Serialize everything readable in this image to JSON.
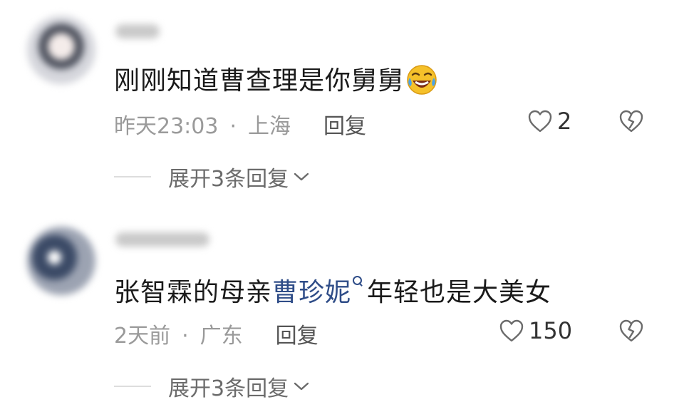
{
  "comments": [
    {
      "text": "刚刚知道曹查理是你舅舅",
      "emoji": "rofl-emoji",
      "time": "昨天23:03",
      "separator": "·",
      "location": "上海",
      "reply_label": "回复",
      "likes": "2",
      "expand_label": "展开3条回复"
    },
    {
      "text_before": "张智霖的母亲",
      "mention": "曹珍妮",
      "text_after": "年轻也是大美女",
      "time": "2天前",
      "separator": "·",
      "location": "广东",
      "reply_label": "回复",
      "likes": "150",
      "expand_label": "展开3条回复"
    }
  ],
  "icons": {
    "like": "heart-outline-icon",
    "dislike": "broken-heart-icon",
    "expand": "chevron-down-icon",
    "mention_search": "search-icon"
  },
  "colors": {
    "mention": "#2f4d88",
    "meta": "#9a9a9a",
    "text": "#1a1a1a"
  }
}
